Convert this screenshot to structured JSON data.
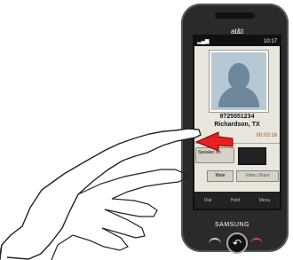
{
  "phone": {
    "carrier": "at&t",
    "brand": "SAMSUNG",
    "status_time": "10:17",
    "caller_number": "9725551234",
    "caller_location": "Richardson, TX",
    "call_timer": "00:03:16",
    "speaker_label": "Speaker on",
    "mute_label": "Mute",
    "video_label": "Video Share",
    "softkeys": [
      "Dial",
      "Hold",
      "Menu"
    ]
  }
}
